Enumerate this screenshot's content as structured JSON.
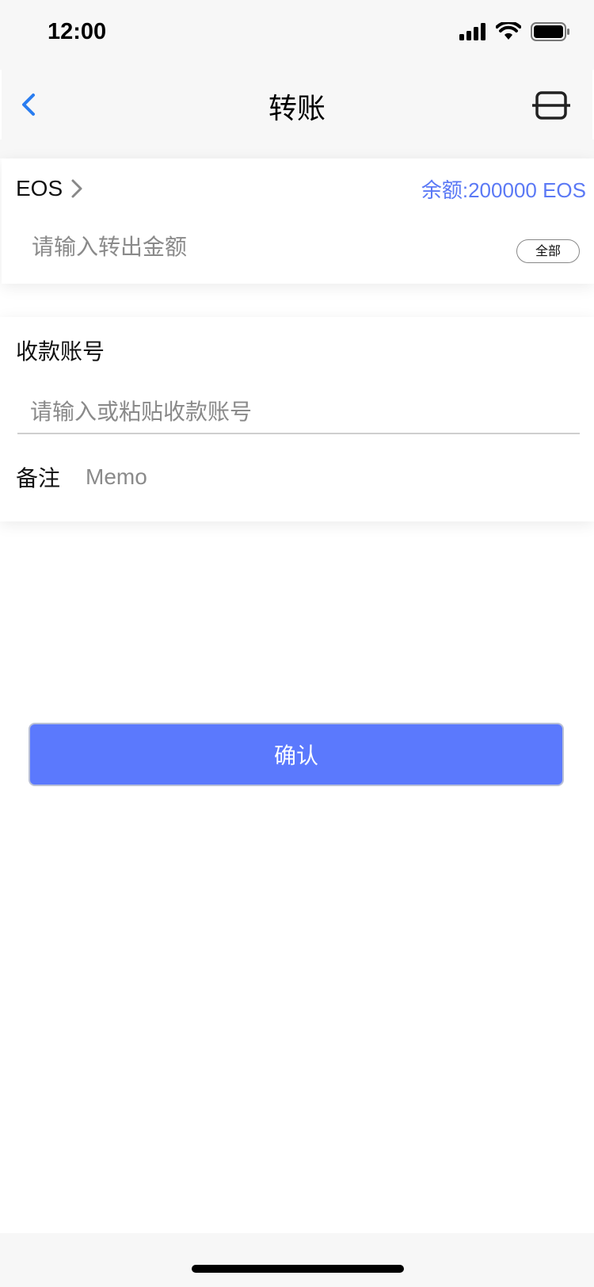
{
  "status_bar": {
    "time": "12:00",
    "icons": [
      "signal-icon",
      "wifi-icon",
      "battery-icon"
    ]
  },
  "nav": {
    "title": "转账",
    "back_icon": "chevron-left-icon",
    "scan_icon": "scan-icon"
  },
  "amount_card": {
    "token": "EOS",
    "balance": "余额:200000 EOS",
    "amount_placeholder": "请输入转出金额",
    "all_button": "全部"
  },
  "recipient_card": {
    "label": "收款账号",
    "address_placeholder": "请输入或粘贴收款账号",
    "memo_label": "备注",
    "memo_placeholder": "Memo"
  },
  "confirm_button": "确认",
  "colors": {
    "accent": "#5b79fd",
    "balance_text": "#5b79f5",
    "back_icon": "#2a7df0",
    "background_gray": "#f7f7f7"
  }
}
